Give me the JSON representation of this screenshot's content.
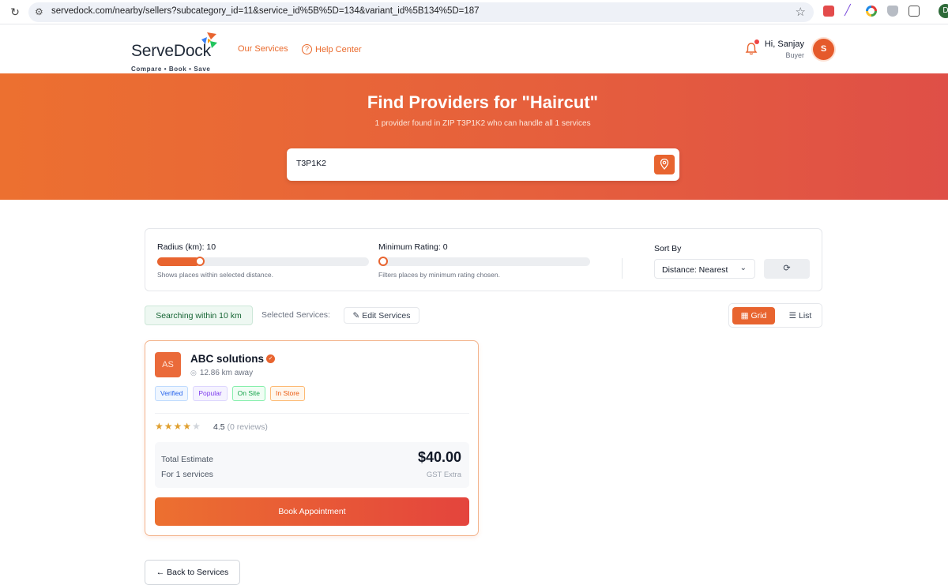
{
  "browser": {
    "url": "servedock.com/nearby/sellers?subcategory_id=11&service_id%5B%5D=134&variant_id%5B134%5D=187",
    "profile_initial": "D"
  },
  "header": {
    "logo_word": "ServeDock",
    "logo_tagline": "Compare • Book • Save",
    "nav": {
      "services": "Our Services",
      "help": "Help Center"
    },
    "user": {
      "greeting": "Hi, Sanjay",
      "role": "Buyer",
      "avatar_initial": "S"
    }
  },
  "hero": {
    "title": "Find Providers for \"Haircut\"",
    "subtitle": "1 provider found in ZIP T3P1K2 who can handle all 1 services",
    "search_value": "T3P1K2"
  },
  "filters": {
    "radius": {
      "label": "Radius (km): 10",
      "hint": "Shows places within selected distance.",
      "value_fraction": 0.2
    },
    "rating": {
      "label": "Minimum Rating: 0",
      "hint": "Filters places by minimum rating chosen.",
      "value_fraction": 0
    },
    "sort": {
      "label": "Sort By",
      "selected": "Distance: Nearest"
    }
  },
  "toolbar": {
    "search_chip": "Searching within 10 km",
    "selected_label": "Selected Services:",
    "edit_label": "Edit Services",
    "grid_label": "Grid",
    "list_label": "List"
  },
  "card": {
    "initials": "AS",
    "name": "ABC solutions",
    "distance": "12.86 km away",
    "badges": [
      "Verified",
      "Popular",
      "On Site",
      "In Store"
    ],
    "rating": "4.5",
    "reviews": "(0 reviews)",
    "stars_filled": 4,
    "estimate_label": "Total Estimate",
    "estimate_sub": "For 1 services",
    "price": "$40.00",
    "gst": "GST Extra",
    "book_label": "Book Appointment"
  },
  "back_label": "Back to Services",
  "colors": {
    "accent": "#e8642f",
    "hero_start": "#ec7030",
    "hero_end": "#df4f47"
  }
}
